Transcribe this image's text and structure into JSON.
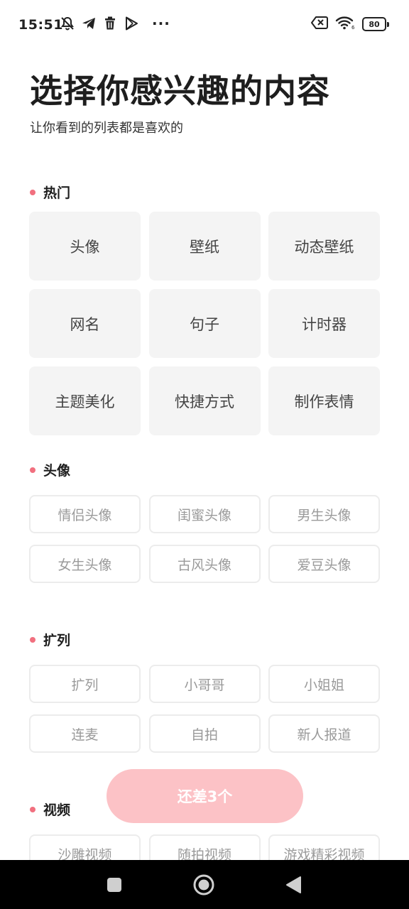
{
  "status_bar": {
    "time": "15:51",
    "left_icons": [
      "muted-bell-icon",
      "telegram-icon",
      "trash-icon",
      "play-store-icon"
    ],
    "more": "···",
    "battery_level": "80"
  },
  "header": {
    "title": "选择你感兴趣的内容",
    "subtitle": "让你看到的列表都是喜欢的"
  },
  "sections": [
    {
      "title": "热门",
      "items": [
        "头像",
        "壁纸",
        "动态壁纸",
        "网名",
        "句子",
        "计时器",
        "主题美化",
        "快捷方式",
        "制作表情"
      ]
    },
    {
      "title": "头像",
      "items": [
        "情侣头像",
        "闺蜜头像",
        "男生头像",
        "女生头像",
        "古风头像",
        "爱豆头像"
      ]
    },
    {
      "title": "扩列",
      "items": [
        "扩列",
        "小哥哥",
        "小姐姐",
        "连麦",
        "自拍",
        "新人报道"
      ]
    },
    {
      "title": "视频",
      "items": [
        "沙雕视频",
        "随拍视频",
        "游戏精彩视频"
      ]
    }
  ],
  "cta": {
    "label": "还差3个"
  },
  "colors": {
    "accent_dot": "#f1707f",
    "cta_bg": "#fcc2c6",
    "tile_bg": "#f4f4f4",
    "outline_border": "#ececec"
  }
}
